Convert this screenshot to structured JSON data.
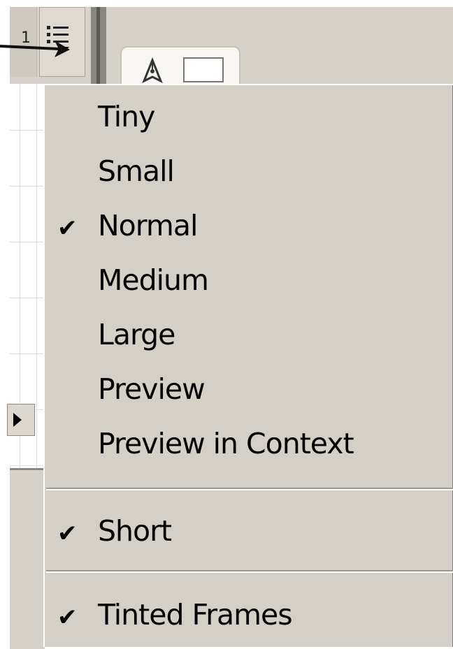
{
  "background": {
    "frame_number": "1",
    "icons": {
      "options": "list-options-icon",
      "pointer": "arrow-pointer-icon",
      "tool": "pen-tool-icon",
      "scroll": "scroll-right-arrow-icon"
    }
  },
  "menu": {
    "items": [
      {
        "label": "Tiny",
        "checked": false
      },
      {
        "label": "Small",
        "checked": false
      },
      {
        "label": "Normal",
        "checked": true
      },
      {
        "label": "Medium",
        "checked": false
      },
      {
        "label": "Large",
        "checked": false
      },
      {
        "label": "Preview",
        "checked": false
      },
      {
        "label": "Preview in Context",
        "checked": false
      },
      {
        "label": "Short",
        "checked": true
      },
      {
        "label": "Tinted Frames",
        "checked": true
      }
    ],
    "check_glyph": "✔"
  },
  "colors": {
    "menu_bg": "#d4d0c8",
    "chrome_bg": "#d6d2ca",
    "text": "#000000"
  }
}
